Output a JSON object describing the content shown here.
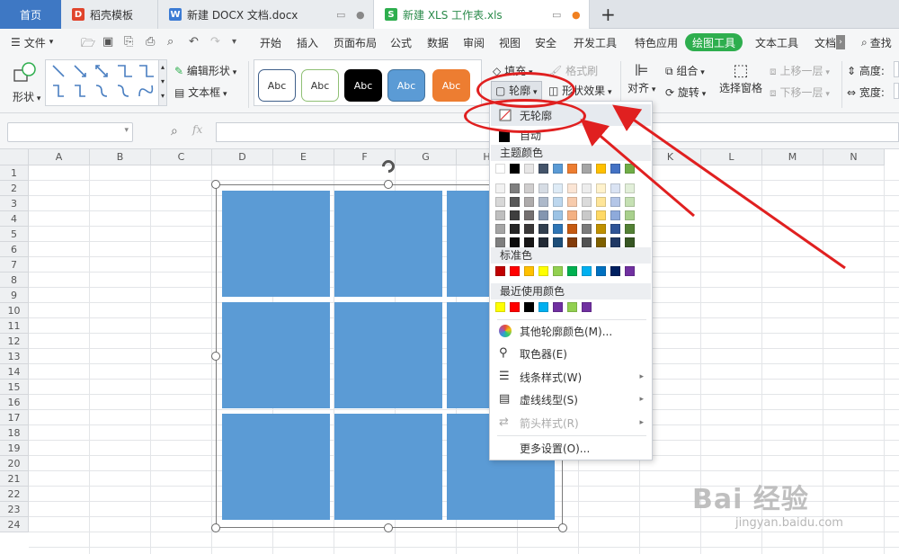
{
  "tabs": [
    {
      "label": "首页"
    },
    {
      "label": "稻壳模板"
    },
    {
      "label": "新建 DOCX 文档.docx"
    },
    {
      "label": "新建 XLS 工作表.xls"
    }
  ],
  "menu": {
    "file": "文件",
    "items": [
      "开始",
      "插入",
      "页面布局",
      "公式",
      "数据",
      "审阅",
      "视图",
      "安全",
      "开发工具",
      "特色应用",
      "绘图工具",
      "文本工具",
      "文档"
    ],
    "active_index": 10,
    "search": "查找"
  },
  "ribbon": {
    "shape": "形状",
    "edit_shape": "编辑形状",
    "text_box": "文本框",
    "style_samples": [
      "Abc",
      "Abc",
      "Abc",
      "Abc",
      "Abc"
    ],
    "style_colors": [
      "#ffffff",
      "#ffffff",
      "#000000",
      "#5b9bd5",
      "#ed7d31"
    ],
    "fill": "填充",
    "format_brush": "格式刷",
    "outline": "轮廓",
    "shape_effect": "形状效果",
    "align": "对齐",
    "group": "组合",
    "rotate": "旋转",
    "selection_pane": "选择窗格",
    "bring_forward": "上移一层",
    "send_backward": "下移一层",
    "height": "高度:",
    "width": "宽度:"
  },
  "formula": {
    "fx": "fx"
  },
  "grid": {
    "columns": [
      "A",
      "B",
      "C",
      "D",
      "E",
      "F",
      "G",
      "H",
      "I",
      "J",
      "K",
      "L",
      "M",
      "N"
    ],
    "rows": [
      "1",
      "2",
      "3",
      "4",
      "5",
      "6",
      "7",
      "8",
      "9",
      "10",
      "11",
      "12",
      "13",
      "14",
      "15",
      "16",
      "17",
      "18",
      "19",
      "20",
      "21",
      "22",
      "23",
      "24"
    ]
  },
  "dropdown": {
    "no_outline": "无轮廓",
    "auto": "自动",
    "theme_colors": "主题颜色",
    "standard_colors": "标准色",
    "recent_colors": "最近使用颜色",
    "more_colors": "其他轮廓颜色(M)...",
    "eyedropper": "取色器(E)",
    "line_style": "线条样式(W)",
    "dash_style": "虚线线型(S)",
    "arrow_style": "箭头样式(R)",
    "more_settings": "更多设置(O)...",
    "theme_top": [
      "#ffffff",
      "#000000",
      "#e7e6e6",
      "#44546a",
      "#5b9bd5",
      "#ed7d31",
      "#a5a5a5",
      "#ffc000",
      "#4472c4",
      "#70ad47"
    ],
    "theme_shades": [
      [
        "#f2f2f2",
        "#7f7f7f",
        "#d0cece",
        "#d6dce4",
        "#deebf6",
        "#fbe5d5",
        "#ededed",
        "#fff2cc",
        "#dae3f3",
        "#e2efd9"
      ],
      [
        "#d8d8d8",
        "#595959",
        "#aeabab",
        "#adb9ca",
        "#bdd7ee",
        "#f7cbac",
        "#dbdbdb",
        "#fee599",
        "#b4c6e7",
        "#c5e0b3"
      ],
      [
        "#bfbfbf",
        "#3f3f3f",
        "#757070",
        "#8496b0",
        "#9cc3e5",
        "#f4b183",
        "#c9c9c9",
        "#ffd965",
        "#8eaadb",
        "#a8d08d"
      ],
      [
        "#a5a5a5",
        "#262626",
        "#3a3838",
        "#323f4f",
        "#2e75b5",
        "#c55a11",
        "#7b7b7b",
        "#bf9000",
        "#2f5496",
        "#538135"
      ],
      [
        "#7f7f7f",
        "#0c0c0c",
        "#171616",
        "#222a35",
        "#1e4e79",
        "#833c0b",
        "#525252",
        "#7f6000",
        "#1f3864",
        "#375623"
      ]
    ],
    "standard": [
      "#c00000",
      "#ff0000",
      "#ffc000",
      "#ffff00",
      "#92d050",
      "#00b050",
      "#00b0f0",
      "#0070c0",
      "#002060",
      "#7030a0"
    ],
    "recent": [
      "#ffff00",
      "#ff0000",
      "#000000",
      "#00b0f0",
      "#7030a0",
      "#92d050",
      "#7030a0"
    ]
  },
  "watermark": {
    "brand": "Bai 经验",
    "url": "jingyan.baidu.com"
  }
}
